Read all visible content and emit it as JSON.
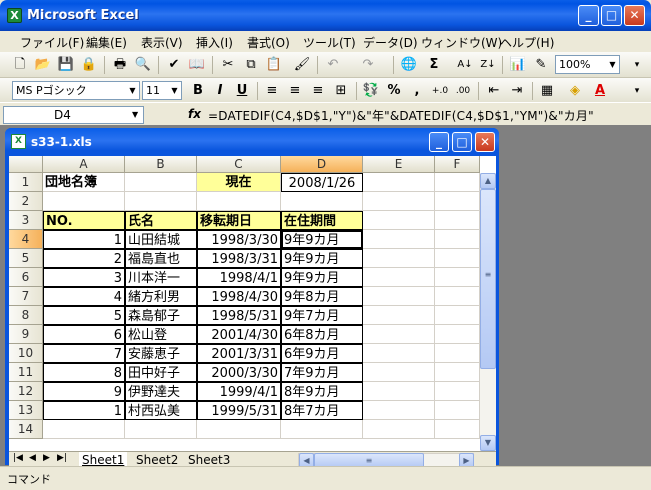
{
  "app": {
    "title": "Microsoft Excel",
    "logo": "X"
  },
  "menu": [
    "ファイル(F)",
    "編集(E)",
    "表示(V)",
    "挿入(I)",
    "書式(O)",
    "ツール(T)",
    "データ(D)",
    "ウィンドウ(W)",
    "ヘルプ(H)"
  ],
  "toolbar": {
    "zoom": "100%",
    "font": "MS Pゴシック",
    "size": "11",
    "bold": "B",
    "italic": "I",
    "underline": "U",
    "percent": "%",
    "comma": ",",
    "sigma": "Σ"
  },
  "formula_bar": {
    "name_box": "D4",
    "fx": "fx",
    "formula": "=DATEDIF(C4,$D$1,\"Y\")&\"年\"&DATEDIF(C4,$D$1,\"YM\")&\"カ月\""
  },
  "workbook": {
    "title": "s33-1.xls"
  },
  "columns": [
    "A",
    "B",
    "C",
    "D",
    "E",
    "F"
  ],
  "rows": [
    "1",
    "2",
    "3",
    "4",
    "5",
    "6",
    "7",
    "8",
    "9",
    "10",
    "11",
    "12",
    "13",
    "14"
  ],
  "cells": {
    "a1": "団地名簿",
    "c1": "現在",
    "d1": "2008/1/26",
    "a3": "NO.",
    "b3": "氏名",
    "c3": "移転期日",
    "d3": "在住期間"
  },
  "records": [
    {
      "no": "1",
      "name": "山田結城",
      "date": "1998/3/30",
      "period": "9年9カ月"
    },
    {
      "no": "2",
      "name": "福島直也",
      "date": "1998/3/31",
      "period": "9年9カ月"
    },
    {
      "no": "3",
      "name": "川本洋一",
      "date": "1998/4/1",
      "period": "9年9カ月"
    },
    {
      "no": "4",
      "name": "緒方利男",
      "date": "1998/4/30",
      "period": "9年8カ月"
    },
    {
      "no": "5",
      "name": "森島郁子",
      "date": "1998/5/31",
      "period": "9年7カ月"
    },
    {
      "no": "6",
      "name": "松山登",
      "date": "2001/4/30",
      "period": "6年8カ月"
    },
    {
      "no": "7",
      "name": "安藤恵子",
      "date": "2001/3/31",
      "period": "6年9カ月"
    },
    {
      "no": "8",
      "name": "田中好子",
      "date": "2000/3/30",
      "period": "7年9カ月"
    },
    {
      "no": "9",
      "name": "伊野達夫",
      "date": "1999/4/1",
      "period": "8年9カ月"
    },
    {
      "no": "1",
      "name": "村西弘美",
      "date": "1999/5/31",
      "period": "8年7カ月"
    }
  ],
  "sheets": [
    "Sheet1",
    "Sheet2",
    "Sheet3"
  ],
  "status": "コマンド"
}
